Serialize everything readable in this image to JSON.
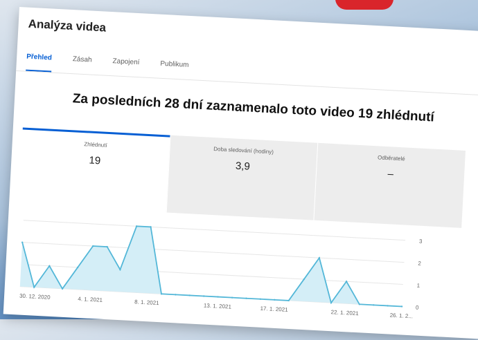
{
  "page": {
    "title": "Analýza videa"
  },
  "tabs": [
    {
      "label": "Přehled",
      "active": true
    },
    {
      "label": "Zásah",
      "active": false
    },
    {
      "label": "Zapojení",
      "active": false
    },
    {
      "label": "Publikum",
      "active": false
    }
  ],
  "headline": "Za posledních 28 dní zaznamenalo toto video 19 zhlédnutí",
  "metrics": [
    {
      "label": "Zhlédnutí",
      "value": "19"
    },
    {
      "label": "Doba sledování (hodiny)",
      "value": "3,9"
    },
    {
      "label": "Odběratelé",
      "value": "–"
    }
  ],
  "colors": {
    "accent": "#065fd4",
    "chart_line": "#53b7d8",
    "chart_fill": "#d4eef7"
  },
  "chart_data": {
    "type": "area",
    "x": [
      "30. 12. 2020",
      "31. 12. 2020",
      "1. 1. 2021",
      "2. 1. 2021",
      "3. 1. 2021",
      "4. 1. 2021",
      "5. 1. 2021",
      "6. 1. 2021",
      "7. 1. 2021",
      "8. 1. 2021",
      "9. 1. 2021",
      "10. 1. 2021",
      "11. 1. 2021",
      "12. 1. 2021",
      "13. 1. 2021",
      "14. 1. 2021",
      "15. 1. 2021",
      "16. 1. 2021",
      "17. 1. 2021",
      "18. 1. 2021",
      "19. 1. 2021",
      "20. 1. 2021",
      "21. 1. 2021",
      "22. 1. 2021",
      "23. 1. 2021",
      "24. 1. 2021",
      "25. 1. 2021",
      "26. 1. 2021"
    ],
    "values": [
      2,
      0,
      1,
      0,
      1,
      2,
      2,
      1,
      3,
      3,
      0,
      0,
      0,
      0,
      0,
      0,
      0,
      0,
      0,
      0,
      1,
      2,
      0,
      1,
      0,
      0,
      0,
      0
    ],
    "x_tick_labels": [
      "30. 12. 2020",
      "4. 1. 2021",
      "8. 1. 2021",
      "13. 1. 2021",
      "17. 1. 2021",
      "22. 1. 2021",
      "26. 1. 2..."
    ],
    "x_tick_index": [
      0,
      5,
      9,
      14,
      18,
      23,
      27
    ],
    "y_ticks": [
      "0",
      "1",
      "2",
      "3"
    ],
    "ylim": [
      0,
      3
    ],
    "grid": true
  }
}
